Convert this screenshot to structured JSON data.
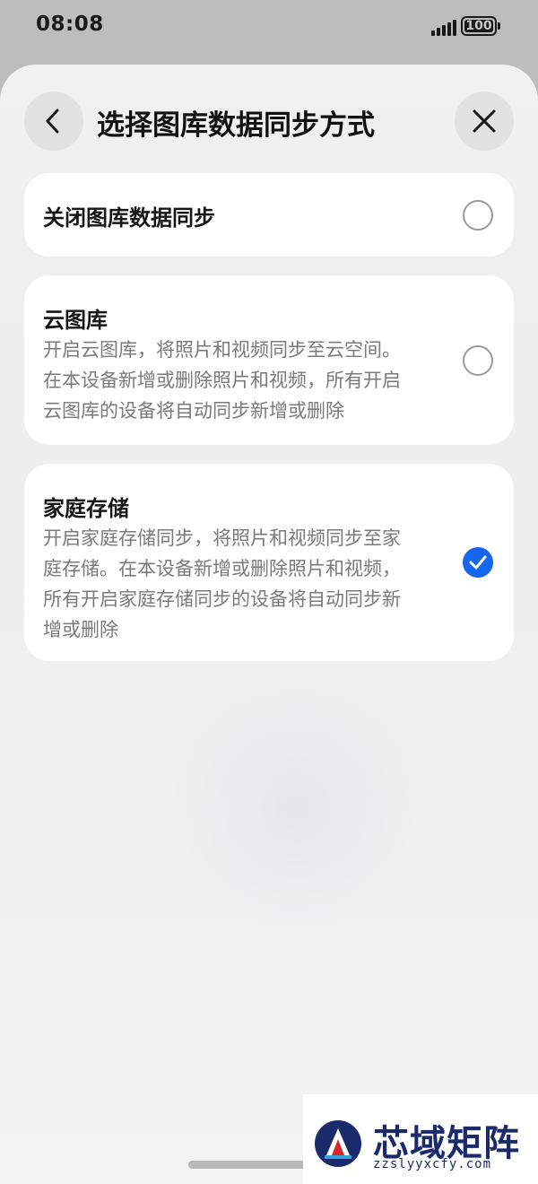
{
  "status_bar": {
    "time": "08:08",
    "battery": "100"
  },
  "header": {
    "title": "选择图库数据同步方式",
    "back_icon": "chevron-left-icon",
    "close_icon": "close-icon"
  },
  "options": [
    {
      "title": "关闭图库数据同步",
      "description": "",
      "selected": false
    },
    {
      "title": "云图库",
      "description_lines": [
        "开启云图库，将照片和视频同步至云空间。",
        "在本设备新增或删除照片和视频，所有开启",
        "云图库的设备将自动同步新增或删除"
      ],
      "selected": false
    },
    {
      "title": "家庭存储",
      "description_lines": [
        "开启家庭存储同步，将照片和视频同步至家",
        "庭存储。在本设备新增或删除照片和视频，",
        "所有开启家庭存储同步的设备将自动同步新",
        "增或删除"
      ],
      "selected": true
    }
  ],
  "colors": {
    "accent": "#1565ef",
    "card": "#ffffff",
    "sheet": "#efefef"
  },
  "watermark": {
    "name": "芯域矩阵",
    "url": "zzslyyxcfy.com"
  }
}
